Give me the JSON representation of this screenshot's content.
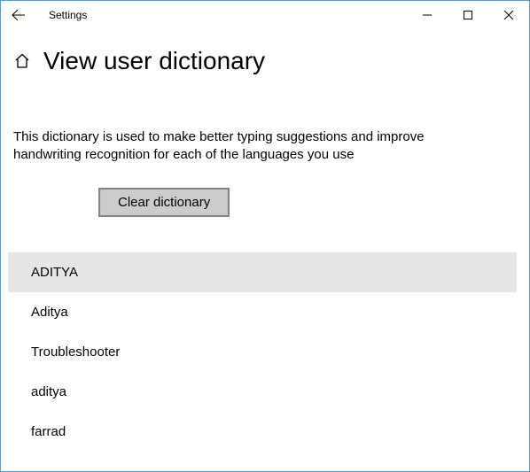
{
  "titlebar": {
    "label": "Settings"
  },
  "header": {
    "title": "View user dictionary"
  },
  "description": "This dictionary is used to make better typing suggestions and improve handwriting recognition for each of the languages you use",
  "buttons": {
    "clear": "Clear dictionary"
  },
  "words": [
    "ADITYA",
    "Aditya",
    "Troubleshooter",
    "aditya",
    "farrad"
  ],
  "selected_index": 0
}
